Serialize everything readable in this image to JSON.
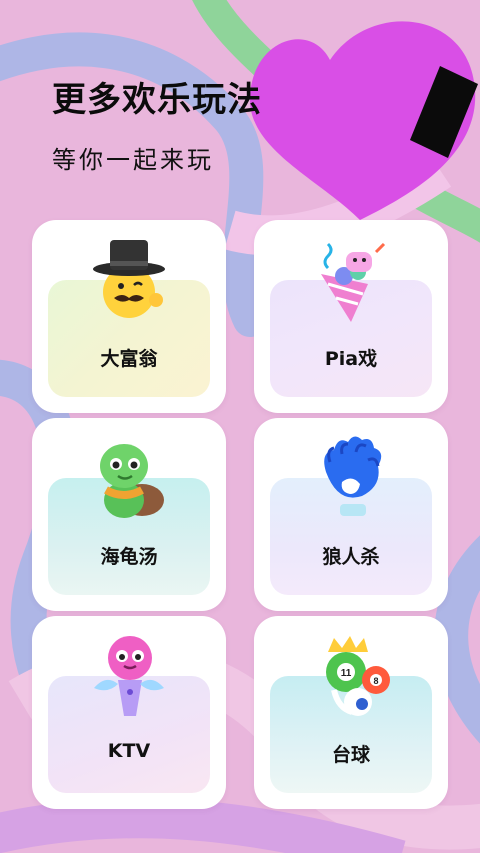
{
  "header": {
    "title": "更多欢乐玩法",
    "subtitle": "等你一起来玩"
  },
  "games": [
    {
      "label": "大富翁",
      "icon": "tophat-mustache-emoji-icon"
    },
    {
      "label": "Pia戏",
      "icon": "party-popper-icon"
    },
    {
      "label": "海龟汤",
      "icon": "turtle-icon"
    },
    {
      "label": "狼人杀",
      "icon": "wolf-paw-glove-icon"
    },
    {
      "label": "KTV",
      "icon": "microphone-character-icon"
    },
    {
      "label": "台球",
      "icon": "billiard-balls-icon"
    }
  ],
  "colors": {
    "background": "#e9b6dc",
    "heart": "#d94fe6",
    "stripe_green": "#8fd49a",
    "stripe_blue": "#a8b4e8"
  }
}
